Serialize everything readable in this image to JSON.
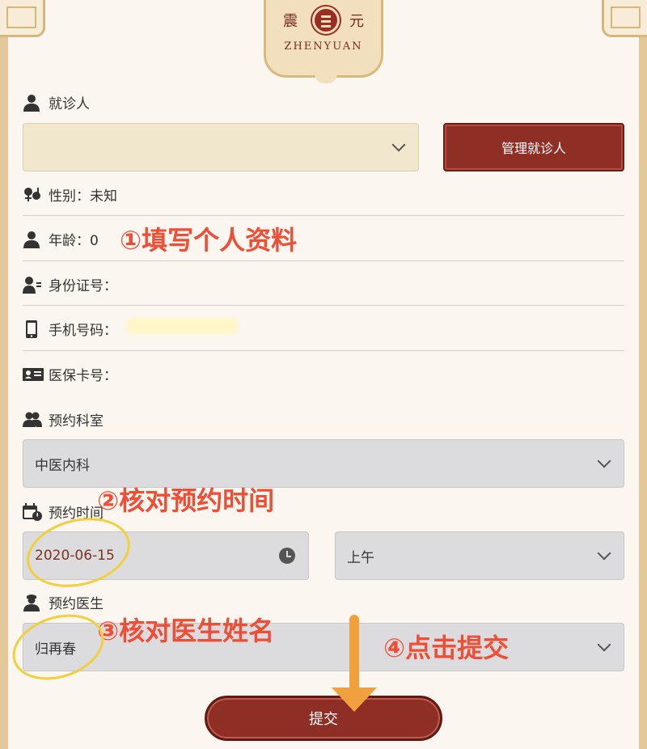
{
  "logo": {
    "left_char": "震",
    "right_char": "元",
    "english": "ZHENYUAN"
  },
  "patient": {
    "label": "就诊人",
    "selected": "",
    "manage_button": "管理就诊人"
  },
  "info": {
    "gender": "性别：未知",
    "age": "年龄：0",
    "id_number": "身份证号：",
    "phone": "手机号码：",
    "insurance_card": "医保卡号："
  },
  "department": {
    "label": "预约科室",
    "selected": "中医内科"
  },
  "appointment_time": {
    "label": "预约时间",
    "date": "2020-06-15",
    "period": "上午"
  },
  "doctor": {
    "label": "预约医生",
    "selected": "归再春"
  },
  "submit_label": "提交",
  "annotations": {
    "step1": "①填写个人资料",
    "step2": "②核对预约时间",
    "step3": "③核对医生姓名",
    "step4": "④点击提交"
  },
  "colors": {
    "brand": "#8f2e25",
    "annotation": "#ef4e36",
    "highlight": "#f1cf3d",
    "arrow": "#f0a03c"
  }
}
